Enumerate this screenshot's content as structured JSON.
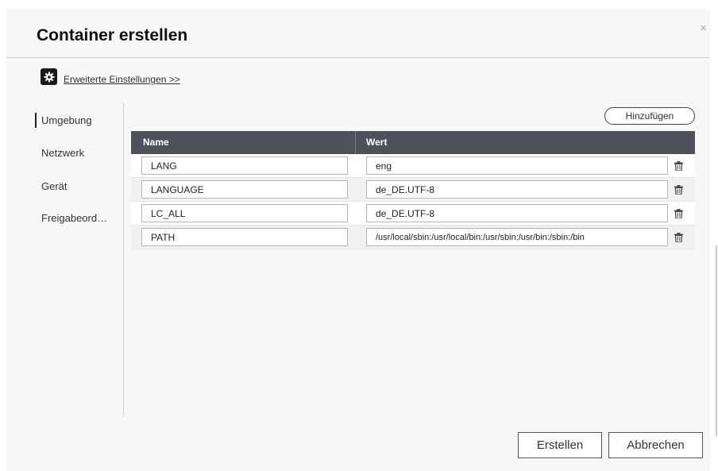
{
  "dialog": {
    "title": "Container erstellen",
    "close_symbol": "×"
  },
  "advanced": {
    "icon": "gear-icon",
    "link_label": "Erweiterte Einstellungen >>"
  },
  "nav": {
    "items": [
      {
        "label": "Umgebung",
        "active": true
      },
      {
        "label": "Netzwerk",
        "active": false
      },
      {
        "label": "Gerät",
        "active": false
      },
      {
        "label": "Freigabeord…",
        "active": false
      }
    ]
  },
  "env": {
    "add_label": "Hinzufügen",
    "columns": {
      "name": "Name",
      "value": "Wert"
    },
    "rows": [
      {
        "name": "LANG",
        "value": "eng"
      },
      {
        "name": "LANGUAGE",
        "value": "de_DE.UTF-8"
      },
      {
        "name": "LC_ALL",
        "value": "de_DE.UTF-8"
      },
      {
        "name": "PATH",
        "value": "/usr/local/sbin:/usr/local/bin:/usr/sbin:/usr/bin:/sbin:/bin"
      }
    ],
    "row_action_icon": "trash-icon"
  },
  "footer": {
    "create_label": "Erstellen",
    "cancel_label": "Abbrechen"
  },
  "colors": {
    "header_bg": "#4d525a",
    "dialog_bg": "#f7f7f7",
    "divider": "#cfcfcf"
  }
}
